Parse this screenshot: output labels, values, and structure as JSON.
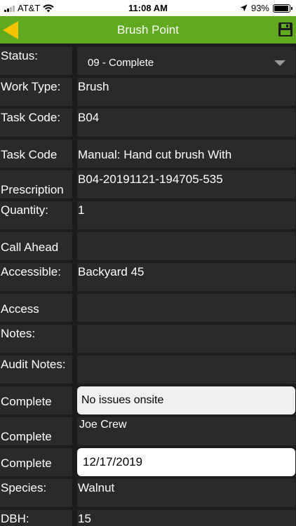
{
  "status_bar": {
    "carrier": "AT&T",
    "time": "11:08 AM",
    "battery": "93%",
    "battery_level": 0.93
  },
  "nav": {
    "title": "Brush Point",
    "back_icon": "back-arrow-icon",
    "save_icon": "floppy-disk-icon",
    "accent_color": "#61a91f",
    "back_color": "#f5c400"
  },
  "fields": {
    "status": {
      "label": "Status:",
      "value": "09 - Complete"
    },
    "work_type": {
      "label": "Work Type:",
      "value": "Brush"
    },
    "task_code": {
      "label": "Task Code:",
      "value": "B04"
    },
    "task_code_manual": {
      "label": "Task Code",
      "value": "Manual: Hand cut brush With"
    },
    "prescription": {
      "label": "Prescription",
      "value": "B04-20191121-194705-535"
    },
    "quantity": {
      "label": "Quantity:",
      "value": "1"
    },
    "call_ahead": {
      "label": "Call Ahead",
      "value": ""
    },
    "accessible": {
      "label": "Accessible:",
      "value": "Backyard 45"
    },
    "access": {
      "label": "Access",
      "value": ""
    },
    "notes": {
      "label": "Notes:",
      "value": ""
    },
    "audit_notes": {
      "label": "Audit Notes:",
      "value": ""
    },
    "complete_notes": {
      "label": "Complete",
      "value": "No issues onsite"
    },
    "complete_by": {
      "label": "Complete",
      "value": "Joe Crew"
    },
    "complete_date": {
      "label": "Complete",
      "value": "12/17/2019"
    },
    "species": {
      "label": "Species:",
      "value": "Walnut"
    },
    "dbh": {
      "label": "DBH:",
      "value": "15"
    }
  }
}
